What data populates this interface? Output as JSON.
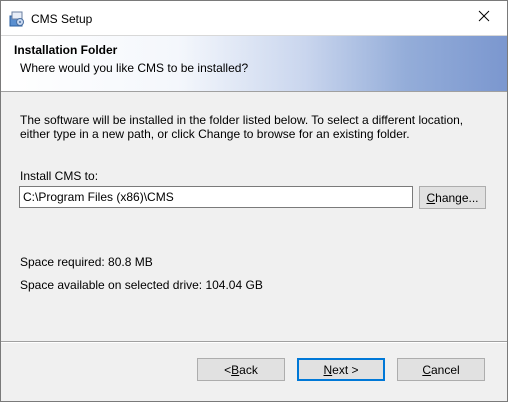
{
  "window": {
    "title": "CMS Setup",
    "icon": "installer-icon",
    "close_icon": "close-icon"
  },
  "banner": {
    "title": "Installation Folder",
    "subtitle": "Where would you like CMS to be installed?"
  },
  "content": {
    "description": "The software will be installed in the folder listed below. To select a different location, either type in a new path, or click Change to browse for an existing folder.",
    "install_label": "Install CMS to:",
    "path_value": "C:\\Program Files (x86)\\CMS",
    "change_label_mnemonic": "C",
    "change_label_rest": "hange...",
    "space_required": "Space required: 80.8 MB",
    "space_available": "Space available on selected drive: 104.04 GB"
  },
  "footer": {
    "back_mnemonic": "< ",
    "back_mnemonic_char": "B",
    "back_rest": "ack",
    "next_mnemonic": "N",
    "next_rest": "ext >",
    "cancel_mnemonic": "C",
    "cancel_rest": "ancel"
  },
  "colors": {
    "window_bg": "#f0f0f0",
    "default_button_border": "#0078d7",
    "banner_gradient_end": "#7b97cf"
  }
}
